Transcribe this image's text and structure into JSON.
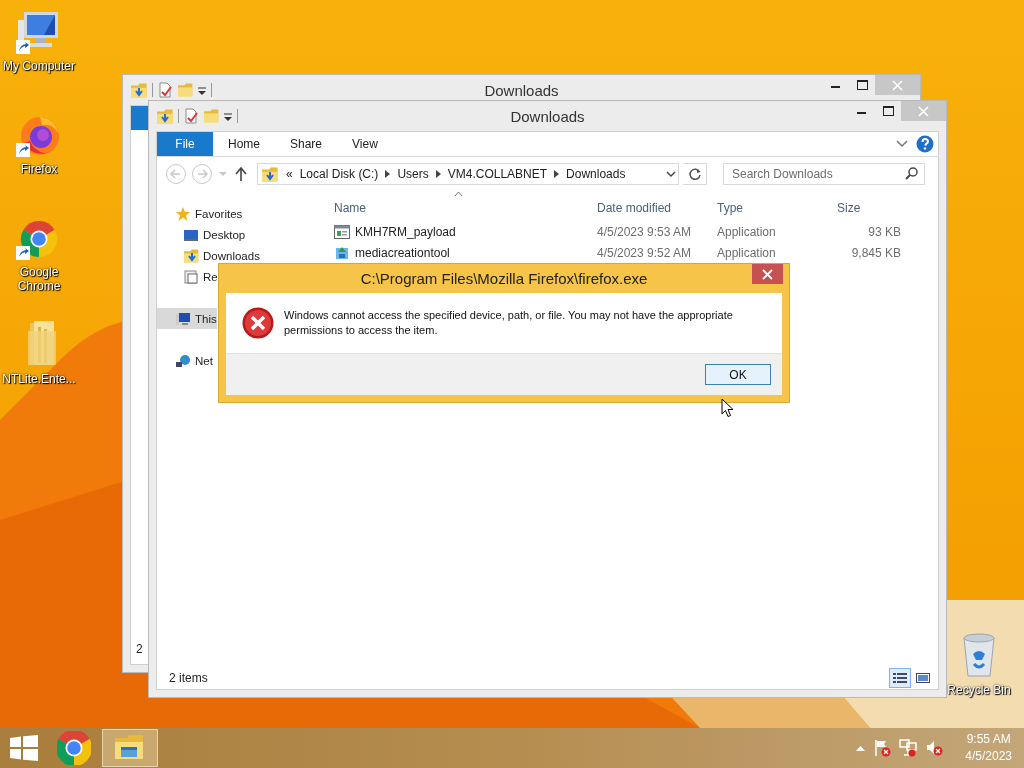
{
  "desktop": {
    "icons": [
      {
        "label": "My Computer",
        "kind": "computer"
      },
      {
        "label": "Firefox",
        "kind": "firefox"
      },
      {
        "label": "Google Chrome",
        "kind": "chrome"
      },
      {
        "label": "NTLite.Ente...",
        "kind": "folder"
      },
      {
        "label": "Recycle Bin",
        "kind": "bin"
      }
    ]
  },
  "back_window": {
    "title": "Downloads",
    "status": "2"
  },
  "window": {
    "title": "Downloads",
    "ribbon_tabs": [
      {
        "label": "File",
        "kind": "menu"
      },
      {
        "label": "Home",
        "kind": "tab"
      },
      {
        "label": "Share",
        "kind": "tab"
      },
      {
        "label": "View",
        "kind": "tab"
      }
    ],
    "path_overflow": "«",
    "path": [
      "Local Disk (C:)",
      "Users",
      "VM4.COLLABNET",
      "Downloads"
    ],
    "search": {
      "placeholder": "Search Downloads"
    },
    "nav": [
      {
        "label": "Favorites",
        "kind": "star",
        "selected": false,
        "children": [
          {
            "label": "Desktop",
            "kind": "desktop",
            "selected": false
          },
          {
            "label": "Downloads",
            "kind": "downloads",
            "selected": false
          },
          {
            "label": "Re",
            "kind": "recent",
            "selected": false
          }
        ]
      },
      {
        "label": "This",
        "kind": "pc",
        "selected": true
      },
      {
        "label": "Net",
        "kind": "network",
        "selected": false
      }
    ],
    "columns": [
      {
        "label": "Name",
        "sorted": true
      },
      {
        "label": "Date modified",
        "sorted": false
      },
      {
        "label": "Type",
        "sorted": false
      },
      {
        "label": "Size",
        "sorted": false
      }
    ],
    "rows": [
      {
        "kind": "exe",
        "name": "KMH7RM_payload",
        "date": "4/5/2023 9:53 AM",
        "type": "Application",
        "size": "93 KB",
        "selected": false
      },
      {
        "kind": "setup",
        "name": "mediacreationtool",
        "date": "4/5/2023 9:52 AM",
        "type": "Application",
        "size": "9,845 KB",
        "selected": false
      }
    ],
    "status": "2 items",
    "views": [
      {
        "kind": "details",
        "selected": true
      },
      {
        "kind": "tiles",
        "selected": false
      }
    ]
  },
  "dialog": {
    "title": "C:\\Program Files\\Mozilla Firefox\\firefox.exe",
    "kind": "error",
    "message": "Windows cannot access the specified device, path, or file. You may not have the appropriate permissions to access the item.",
    "button": "OK"
  },
  "taskbar": {
    "apps": [
      {
        "kind": "chrome",
        "active": false
      },
      {
        "kind": "explorer",
        "active": true
      }
    ],
    "clock": {
      "time": "9:55 AM",
      "date": "4/5/2023"
    }
  }
}
